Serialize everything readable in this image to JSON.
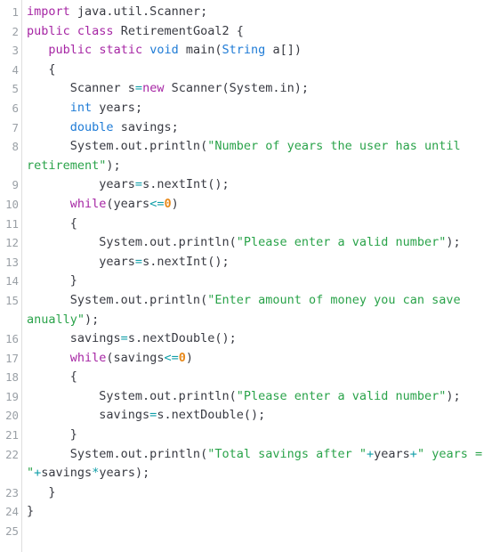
{
  "editor": {
    "language": "java",
    "background_color": "#ffffff",
    "gutter_rule_color": "#dedede",
    "line_number_color": "#9aa0a6",
    "plain_text_color": "#383a42",
    "total_numbered_lines": 25
  },
  "syntax_colors": {
    "keyword": "#a626a4",
    "type": "#1e7bd6",
    "string": "#2aa34a",
    "operator": "#0f9ea8",
    "number": "#e8891a",
    "plain": "#383a42"
  },
  "lines": [
    {
      "number": "1",
      "wrapped": false,
      "tokens": [
        {
          "t": "import",
          "c": "kw"
        },
        {
          "t": " java.util.Scanner;",
          "c": "pl"
        }
      ]
    },
    {
      "number": "2",
      "wrapped": false,
      "tokens": [
        {
          "t": "public",
          "c": "kw"
        },
        {
          "t": " ",
          "c": "pl"
        },
        {
          "t": "class",
          "c": "kw"
        },
        {
          "t": " RetirementGoal2 {",
          "c": "pl"
        }
      ]
    },
    {
      "number": "3",
      "wrapped": false,
      "tokens": [
        {
          "t": "   ",
          "c": "pl"
        },
        {
          "t": "public",
          "c": "kw"
        },
        {
          "t": " ",
          "c": "pl"
        },
        {
          "t": "static",
          "c": "kw"
        },
        {
          "t": " ",
          "c": "pl"
        },
        {
          "t": "void",
          "c": "type"
        },
        {
          "t": " main(",
          "c": "pl"
        },
        {
          "t": "String",
          "c": "type"
        },
        {
          "t": " a[])",
          "c": "pl"
        }
      ]
    },
    {
      "number": "4",
      "wrapped": false,
      "tokens": [
        {
          "t": "   {",
          "c": "pl"
        }
      ]
    },
    {
      "number": "5",
      "wrapped": false,
      "tokens": [
        {
          "t": "      Scanner s",
          "c": "pl"
        },
        {
          "t": "=",
          "c": "op"
        },
        {
          "t": "new",
          "c": "kw"
        },
        {
          "t": " Scanner(System.in);",
          "c": "pl"
        }
      ]
    },
    {
      "number": "6",
      "wrapped": false,
      "tokens": [
        {
          "t": "      ",
          "c": "pl"
        },
        {
          "t": "int",
          "c": "type"
        },
        {
          "t": " years;",
          "c": "pl"
        }
      ]
    },
    {
      "number": "7",
      "wrapped": false,
      "tokens": [
        {
          "t": "      ",
          "c": "pl"
        },
        {
          "t": "double",
          "c": "type"
        },
        {
          "t": " savings;",
          "c": "pl"
        }
      ]
    },
    {
      "number": "8",
      "wrapped": false,
      "tokens": [
        {
          "t": "      System.out.println(",
          "c": "pl"
        },
        {
          "t": "\"Number of years the user has until",
          "c": "str"
        }
      ]
    },
    {
      "number": "",
      "wrapped": true,
      "tokens": [
        {
          "t": "retirement\"",
          "c": "str"
        },
        {
          "t": ");",
          "c": "pl"
        }
      ]
    },
    {
      "number": "9",
      "wrapped": false,
      "tokens": [
        {
          "t": "          years",
          "c": "pl"
        },
        {
          "t": "=",
          "c": "op"
        },
        {
          "t": "s.nextInt();",
          "c": "pl"
        }
      ]
    },
    {
      "number": "10",
      "wrapped": false,
      "tokens": [
        {
          "t": "      ",
          "c": "pl"
        },
        {
          "t": "while",
          "c": "kw"
        },
        {
          "t": "(years",
          "c": "pl"
        },
        {
          "t": "<=",
          "c": "op"
        },
        {
          "t": "0",
          "c": "num"
        },
        {
          "t": ")",
          "c": "pl"
        }
      ]
    },
    {
      "number": "11",
      "wrapped": false,
      "tokens": [
        {
          "t": "      {",
          "c": "pl"
        }
      ]
    },
    {
      "number": "12",
      "wrapped": false,
      "tokens": [
        {
          "t": "          System.out.println(",
          "c": "pl"
        },
        {
          "t": "\"Please enter a valid number\"",
          "c": "str"
        },
        {
          "t": ");",
          "c": "pl"
        }
      ]
    },
    {
      "number": "13",
      "wrapped": false,
      "tokens": [
        {
          "t": "          years",
          "c": "pl"
        },
        {
          "t": "=",
          "c": "op"
        },
        {
          "t": "s.nextInt();",
          "c": "pl"
        }
      ]
    },
    {
      "number": "14",
      "wrapped": false,
      "tokens": [
        {
          "t": "      }",
          "c": "pl"
        }
      ]
    },
    {
      "number": "15",
      "wrapped": false,
      "tokens": [
        {
          "t": "      System.out.println(",
          "c": "pl"
        },
        {
          "t": "\"Enter amount of money you can save",
          "c": "str"
        }
      ]
    },
    {
      "number": "",
      "wrapped": true,
      "tokens": [
        {
          "t": "anually\"",
          "c": "str"
        },
        {
          "t": ");",
          "c": "pl"
        }
      ]
    },
    {
      "number": "16",
      "wrapped": false,
      "tokens": [
        {
          "t": "      savings",
          "c": "pl"
        },
        {
          "t": "=",
          "c": "op"
        },
        {
          "t": "s.nextDouble();",
          "c": "pl"
        }
      ]
    },
    {
      "number": "17",
      "wrapped": false,
      "tokens": [
        {
          "t": "      ",
          "c": "pl"
        },
        {
          "t": "while",
          "c": "kw"
        },
        {
          "t": "(savings",
          "c": "pl"
        },
        {
          "t": "<=",
          "c": "op"
        },
        {
          "t": "0",
          "c": "num"
        },
        {
          "t": ")",
          "c": "pl"
        }
      ]
    },
    {
      "number": "18",
      "wrapped": false,
      "tokens": [
        {
          "t": "      {",
          "c": "pl"
        }
      ]
    },
    {
      "number": "19",
      "wrapped": false,
      "tokens": [
        {
          "t": "          System.out.println(",
          "c": "pl"
        },
        {
          "t": "\"Please enter a valid number\"",
          "c": "str"
        },
        {
          "t": ");",
          "c": "pl"
        }
      ]
    },
    {
      "number": "20",
      "wrapped": false,
      "tokens": [
        {
          "t": "          savings",
          "c": "pl"
        },
        {
          "t": "=",
          "c": "op"
        },
        {
          "t": "s.nextDouble();",
          "c": "pl"
        }
      ]
    },
    {
      "number": "21",
      "wrapped": false,
      "tokens": [
        {
          "t": "      }",
          "c": "pl"
        }
      ]
    },
    {
      "number": "22",
      "wrapped": false,
      "tokens": [
        {
          "t": "      System.out.println(",
          "c": "pl"
        },
        {
          "t": "\"Total savings after \"",
          "c": "str"
        },
        {
          "t": "+",
          "c": "op"
        },
        {
          "t": "years",
          "c": "pl"
        },
        {
          "t": "+",
          "c": "op"
        },
        {
          "t": "\" years =",
          "c": "str"
        }
      ]
    },
    {
      "number": "",
      "wrapped": true,
      "tokens": [
        {
          "t": "\"",
          "c": "str"
        },
        {
          "t": "+",
          "c": "op"
        },
        {
          "t": "savings",
          "c": "pl"
        },
        {
          "t": "*",
          "c": "op"
        },
        {
          "t": "years);",
          "c": "pl"
        }
      ]
    },
    {
      "number": "23",
      "wrapped": false,
      "tokens": [
        {
          "t": "   }",
          "c": "pl"
        }
      ]
    },
    {
      "number": "24",
      "wrapped": false,
      "tokens": [
        {
          "t": "}",
          "c": "pl"
        }
      ]
    },
    {
      "number": "25",
      "wrapped": false,
      "tokens": []
    }
  ],
  "source_text": "import java.util.Scanner;\npublic class RetirementGoal2 {\n   public static void main(String a[])\n   {\n      Scanner s=new Scanner(System.in);\n      int years;\n      double savings;\n      System.out.println(\"Number of years the user has until retirement\");\n          years=s.nextInt();\n      while(years<=0)\n      {\n          System.out.println(\"Please enter a valid number\");\n          years=s.nextInt();\n      }\n      System.out.println(\"Enter amount of money you can save anually\");\n      savings=s.nextDouble();\n      while(savings<=0)\n      {\n          System.out.println(\"Please enter a valid number\");\n          savings=s.nextDouble();\n      }\n      System.out.println(\"Total savings after \"+years+\" years = \"+savings*years);\n   }\n}\n"
}
